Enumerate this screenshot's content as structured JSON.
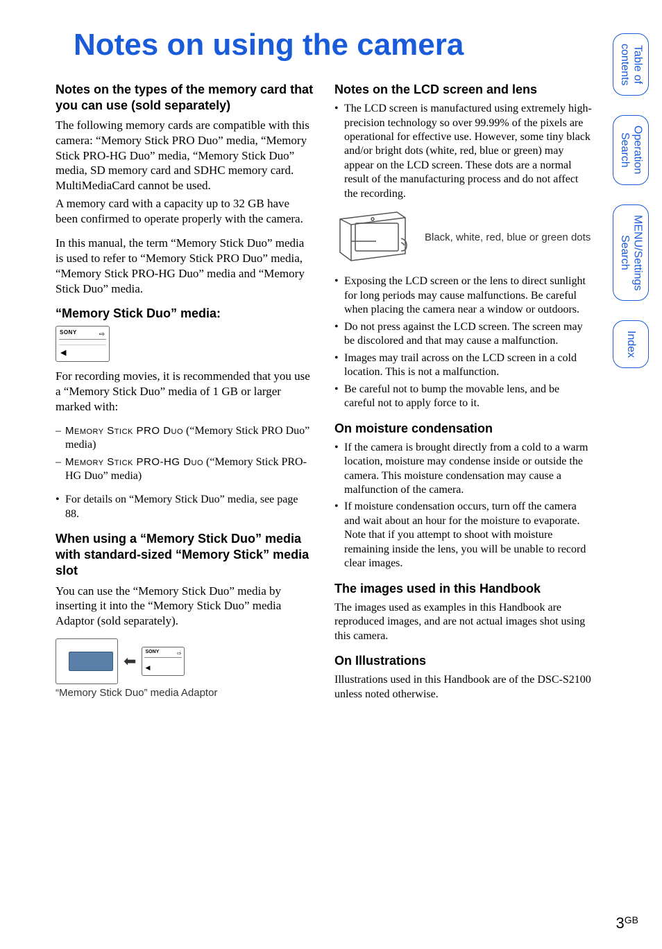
{
  "title": "Notes on using the camera",
  "left": {
    "h_memcard": "Notes on the types of the memory card that you can use (sold separately)",
    "p_compat": "The following memory cards are compatible with this camera: “Memory Stick PRO Duo” media, “Memory Stick PRO-HG Duo” media, “Memory Stick Duo” media, SD memory card and SDHC memory card. MultiMediaCard cannot be used.",
    "p_capacity": "A memory card with a capacity up to 32 GB have been confirmed to operate properly with the camera.",
    "p_term": "In this manual, the term “Memory Stick Duo” media is used to refer to “Memory Stick PRO Duo” media, “Memory Stick PRO-HG Duo” media and “Memory Stick Duo” media.",
    "h_msduo": "“Memory Stick Duo” media:",
    "p_recmovies": "For recording movies, it is recommended that you use a “Memory Stick Duo” media of 1 GB or larger marked with:",
    "brand1_pre": "Memory Stick PRO Duo",
    "brand1_post": " (“Memory Stick PRO Duo” media)",
    "brand2_pre": "Memory Stick PRO-HG Duo",
    "brand2_post": " (“Memory Stick PRO-HG Duo” media)",
    "bullet_page88": "For details on “Memory Stick Duo” media, see page 88.",
    "h_slot": "When using a “Memory Stick Duo” media with standard-sized “Memory Stick” media slot",
    "p_adaptor": "You can use the “Memory Stick Duo” media by inserting it into the “Memory Stick Duo” media Adaptor (sold separately).",
    "adaptor_caption": "“Memory Stick Duo” media Adaptor",
    "card_sony": "SONY"
  },
  "right": {
    "h_lcd": "Notes on the LCD screen and lens",
    "b_lcd1": "The LCD screen is manufactured using extremely high-precision technology so over 99.99% of the pixels are operational for effective use. However, some tiny black and/or bright dots (white, red, blue or green) may appear on the LCD screen. These dots are a normal result of the manufacturing process and do not affect the recording.",
    "lcd_caption": "Black, white, red, blue or green dots",
    "b_lcd2": "Exposing the LCD screen or the lens to direct sunlight for long periods may cause malfunctions. Be careful when placing the camera near a window or outdoors.",
    "b_lcd3": "Do not press against the LCD screen. The screen may be discolored and that may cause a malfunction.",
    "b_lcd4": "Images may trail across on the LCD screen in a cold location. This is not a malfunction.",
    "b_lcd5": "Be careful not to bump the movable lens, and be careful not to apply force to it.",
    "h_moist": "On moisture condensation",
    "b_m1": "If the camera is brought directly from a cold to a warm location, moisture may condense inside or outside the camera. This moisture condensation may cause a malfunction of the camera.",
    "b_m2": "If moisture condensation occurs, turn off the camera and wait about an hour for the moisture to evaporate. Note that if you attempt to shoot with moisture remaining inside the lens, you will be unable to record clear images.",
    "h_images": "The images used in this Handbook",
    "p_images": "The images used as examples in this Handbook are reproduced images, and are not actual images shot using this camera.",
    "h_illus": "On Illustrations",
    "p_illus": "Illustrations used in this Handbook are of the DSC-S2100 unless noted otherwise."
  },
  "tabs": {
    "toc": "Table of\ncontents",
    "op": "Operation\nSearch",
    "menu": "MENU/Settings\nSearch",
    "index": "Index"
  },
  "page": {
    "num": "3",
    "suffix": "GB"
  }
}
